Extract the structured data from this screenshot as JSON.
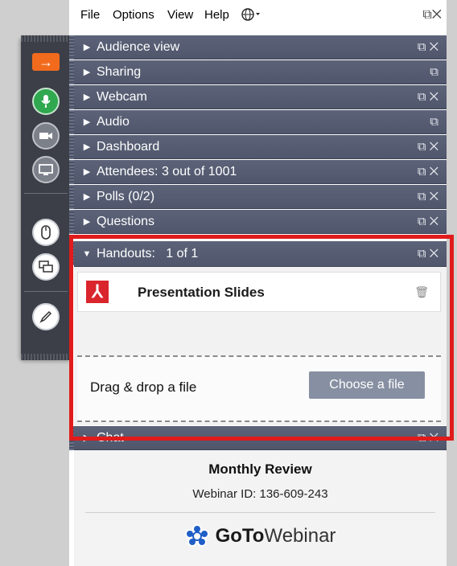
{
  "menu": {
    "file": "File",
    "options": "Options",
    "view": "View",
    "help": "Help",
    "globe_icon": "globe-icon",
    "window_controls": "⧉✕"
  },
  "rows": [
    {
      "label": "Audience view",
      "icons": "⧉✕"
    },
    {
      "label": "Sharing",
      "icons": "⧉"
    },
    {
      "label": "Webcam",
      "icons": "⧉✕"
    },
    {
      "label": "Audio",
      "icons": "⧉"
    },
    {
      "label": "Dashboard",
      "icons": "⧉✕"
    },
    {
      "label": "Attendees: 3 out of 1001",
      "icons": "⧉✕"
    },
    {
      "label": "Polls (0/2)",
      "icons": "⧉✕"
    },
    {
      "label": "Questions",
      "icons": "⧉✕"
    },
    {
      "label": "Handouts:   1 of 1",
      "icons": "⧉✕"
    },
    {
      "label": "Chat",
      "icons": "⧉✕"
    }
  ],
  "handouts": {
    "file_name": "Presentation Slides",
    "drop_label": "Drag & drop a file",
    "choose_button": "Choose a file"
  },
  "footer": {
    "title": "Monthly Review",
    "webinar_id": "Webinar ID: 136-609-243",
    "logo_goto": "GoTo",
    "logo_webinar": "Webinar"
  },
  "colors": {
    "row_bg": "#565d73",
    "highlight": "#e11b1b",
    "orange": "#f26b1d",
    "mic_green": "#2fa84f",
    "pdf_red": "#d9252b",
    "button": "#8790a2",
    "logo_blue": "#1f5fc7"
  }
}
